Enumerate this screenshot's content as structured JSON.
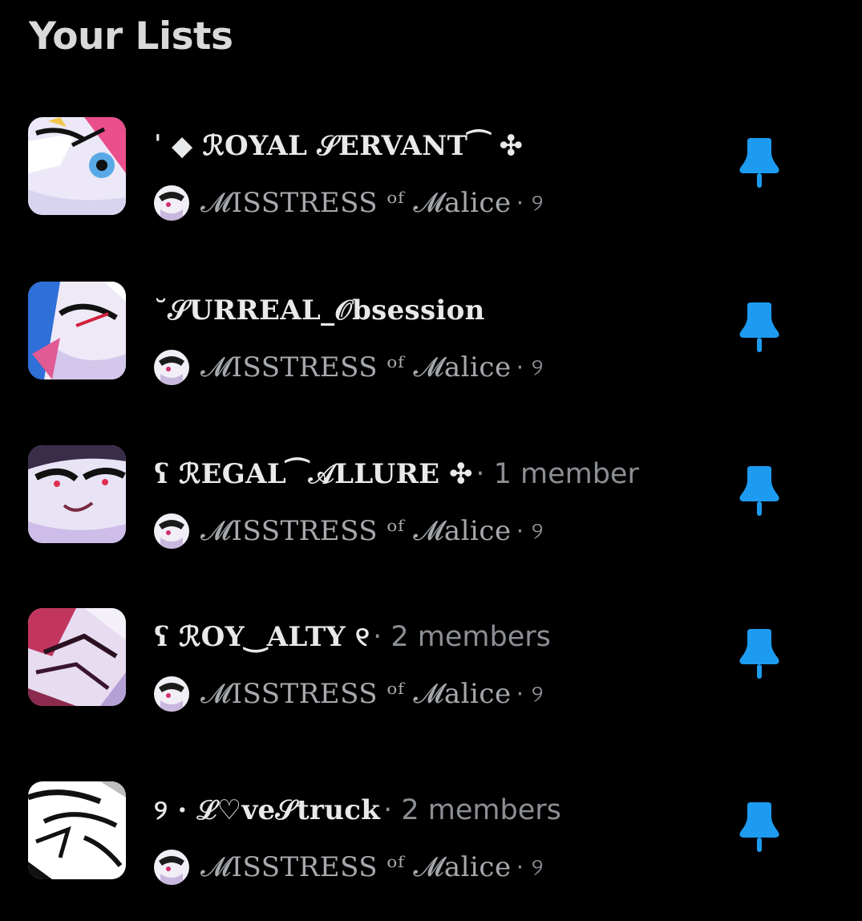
{
  "page": {
    "title": "Your Lists"
  },
  "accent_color": "#1d9bf0",
  "lists": [
    {
      "name": "ˈ ◆ ℛOYAL 𝒮ERVANT⁀ ✣",
      "members": "",
      "owner": "𝓜ISSTRESS ᵒᶠ 𝓜alice",
      "owner_suffix": "· ୨",
      "pin_icon": "pin-icon"
    },
    {
      "name": "˘𝒮URREAL_𝒪bsession",
      "members": "",
      "owner": "𝓜ISSTRESS ᵒᶠ 𝓜alice",
      "owner_suffix": "· ୨",
      "pin_icon": "pin-icon"
    },
    {
      "name": "ʕ ℛEGAL⁀𝒜LLURE ✣",
      "members": "· 1 member",
      "owner": "𝓜ISSTRESS ᵒᶠ 𝓜alice",
      "owner_suffix": "· ୨",
      "pin_icon": "pin-icon"
    },
    {
      "name": "ʕ ℛOY‿ALTY ୧",
      "members": "· 2 members",
      "owner": "𝓜ISSTRESS ᵒᶠ 𝓜alice",
      "owner_suffix": "· ୨",
      "pin_icon": "pin-icon"
    },
    {
      "name": "୨ · ℒ♡ve𝒮truck",
      "members": "· 2 members",
      "owner": "𝓜ISSTRESS ᵒᶠ 𝓜alice",
      "owner_suffix": "· ୨",
      "pin_icon": "pin-icon"
    }
  ]
}
